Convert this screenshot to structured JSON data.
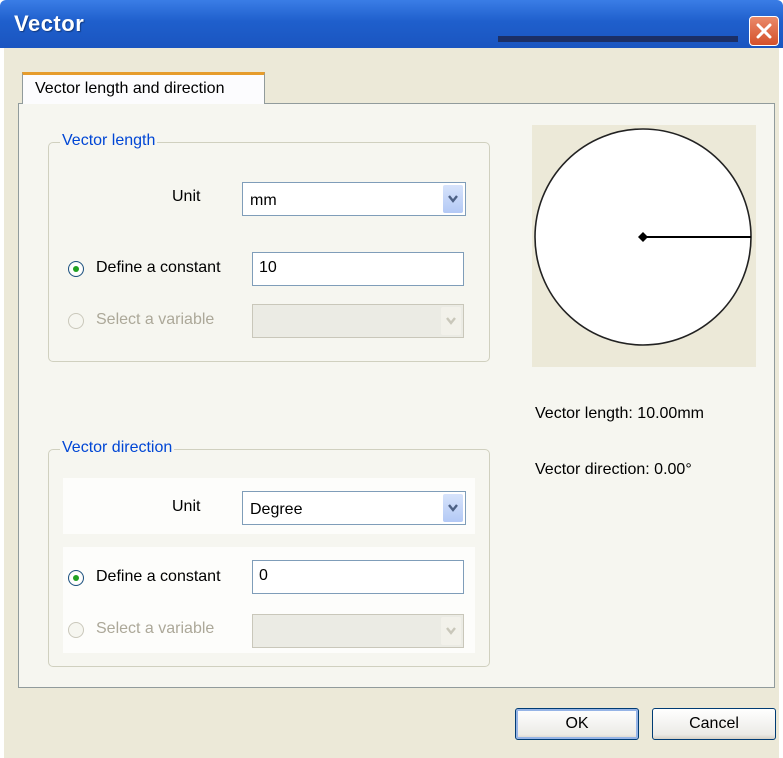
{
  "window": {
    "title": "Vector"
  },
  "tab": {
    "label": "Vector length and direction"
  },
  "length_group": {
    "title": "Vector length",
    "unit_label": "Unit",
    "unit_value": "mm",
    "define_constant_label": "Define a constant",
    "constant_value": "10",
    "define_constant_selected": true,
    "select_variable_label": "Select a variable",
    "variable_value": ""
  },
  "direction_group": {
    "title": "Vector direction",
    "unit_label": "Unit",
    "unit_value": "Degree",
    "define_constant_label": "Define a constant",
    "constant_value": "0",
    "define_constant_selected": true,
    "select_variable_label": "Select a variable",
    "variable_value": ""
  },
  "preview": {
    "length_text": "Vector length: 10.00mm",
    "direction_text": "Vector direction: 0.00°"
  },
  "buttons": {
    "ok": "OK",
    "cancel": "Cancel"
  },
  "colors": {
    "title_bar": "#2563d6",
    "group_title": "#0046d5",
    "radio_dot": "#21a121",
    "close_button": "#d4502a"
  },
  "icons": {
    "close": "close-icon",
    "dropdown": "chevron-down-icon"
  }
}
